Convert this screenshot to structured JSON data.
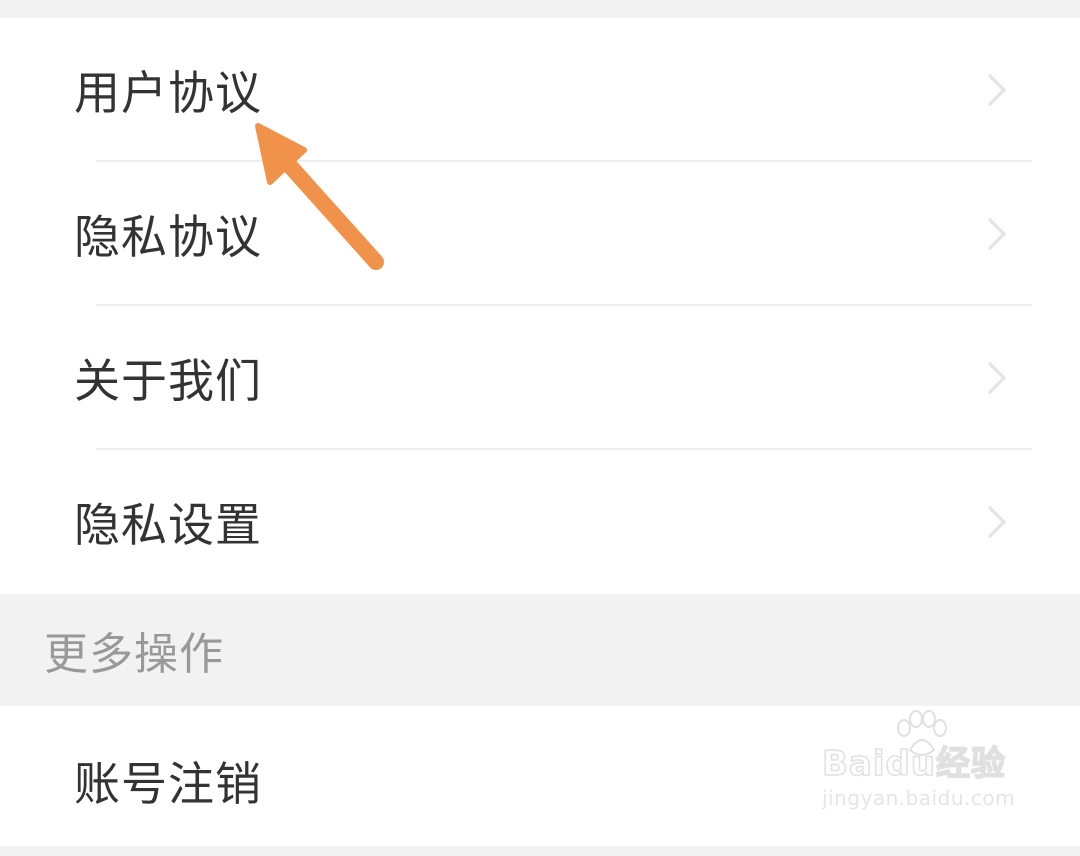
{
  "settings": {
    "items": [
      {
        "label": "用户协议"
      },
      {
        "label": "隐私协议"
      },
      {
        "label": "关于我们"
      },
      {
        "label": "隐私设置"
      }
    ]
  },
  "more_section": {
    "header": "更多操作",
    "items": [
      {
        "label": "账号注销"
      }
    ]
  },
  "watermark": {
    "brand": "Baidu经验",
    "url": "jingyan.baidu.com"
  },
  "colors": {
    "annotation_arrow": "#f0924a",
    "background": "#f2f2f2",
    "row_text": "#333333",
    "section_text": "#999999"
  },
  "icons": {
    "row_chevron": "chevron-right-icon"
  }
}
